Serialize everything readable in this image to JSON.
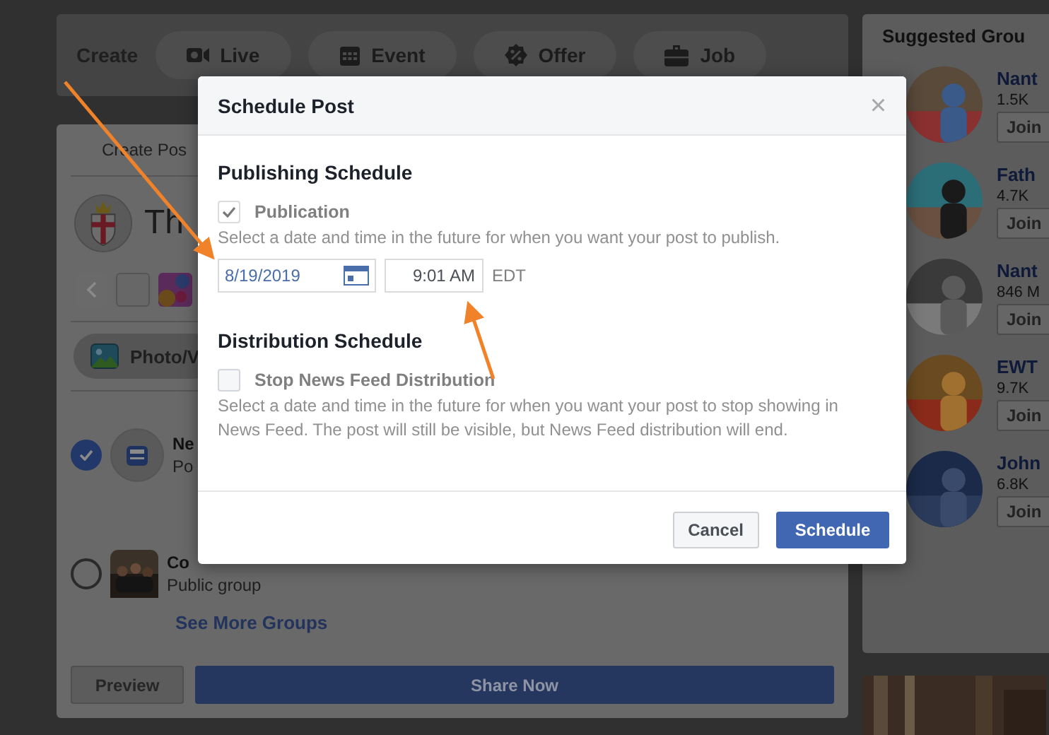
{
  "create_bar": {
    "label": "Create",
    "actions": [
      {
        "label": "Live"
      },
      {
        "label": "Event"
      },
      {
        "label": "Offer"
      },
      {
        "label": "Job"
      }
    ]
  },
  "composer": {
    "tab": "Create Pos",
    "page_name": "Th",
    "photo_button": "Photo/V",
    "destinations": [
      {
        "kind": "feed",
        "name": "Ne",
        "detail": "Po",
        "selected": true
      },
      {
        "kind": "group",
        "name": "Co",
        "detail": "Public group",
        "selected": false
      }
    ],
    "see_more": "See More Groups",
    "preview": "Preview",
    "share": "Share Now"
  },
  "suggested_groups": {
    "title": "Suggested Grou",
    "groups": [
      {
        "name": "Nant",
        "members": "1.5K",
        "join": "Join"
      },
      {
        "name": "Fath",
        "members": "4.7K",
        "join": "Join"
      },
      {
        "name": "Nant",
        "members": "846 M",
        "join": "Join"
      },
      {
        "name": "EWT",
        "members": "9.7K",
        "join": "Join"
      },
      {
        "name": "John",
        "members": "6.8K",
        "join": "Join"
      }
    ]
  },
  "dialog": {
    "title": "Schedule Post",
    "close": "×",
    "sections": [
      {
        "heading": "Publishing Schedule",
        "option": "Publication",
        "checked": true,
        "description": "Select a date and time in the future for when you want your post to publish.",
        "date": "8/19/2019",
        "time": "9:01 AM",
        "zone": "EDT"
      },
      {
        "heading": "Distribution Schedule",
        "option": "Stop News Feed Distribution",
        "checked": false,
        "description": "Select a date and time in the future for when you want your post to stop showing in News Feed. The post will still be visible, but News Feed distribution will end."
      }
    ],
    "buttons": [
      {
        "kind": "secondary",
        "label": "Cancel"
      },
      {
        "kind": "primary",
        "label": "Schedule"
      }
    ]
  }
}
